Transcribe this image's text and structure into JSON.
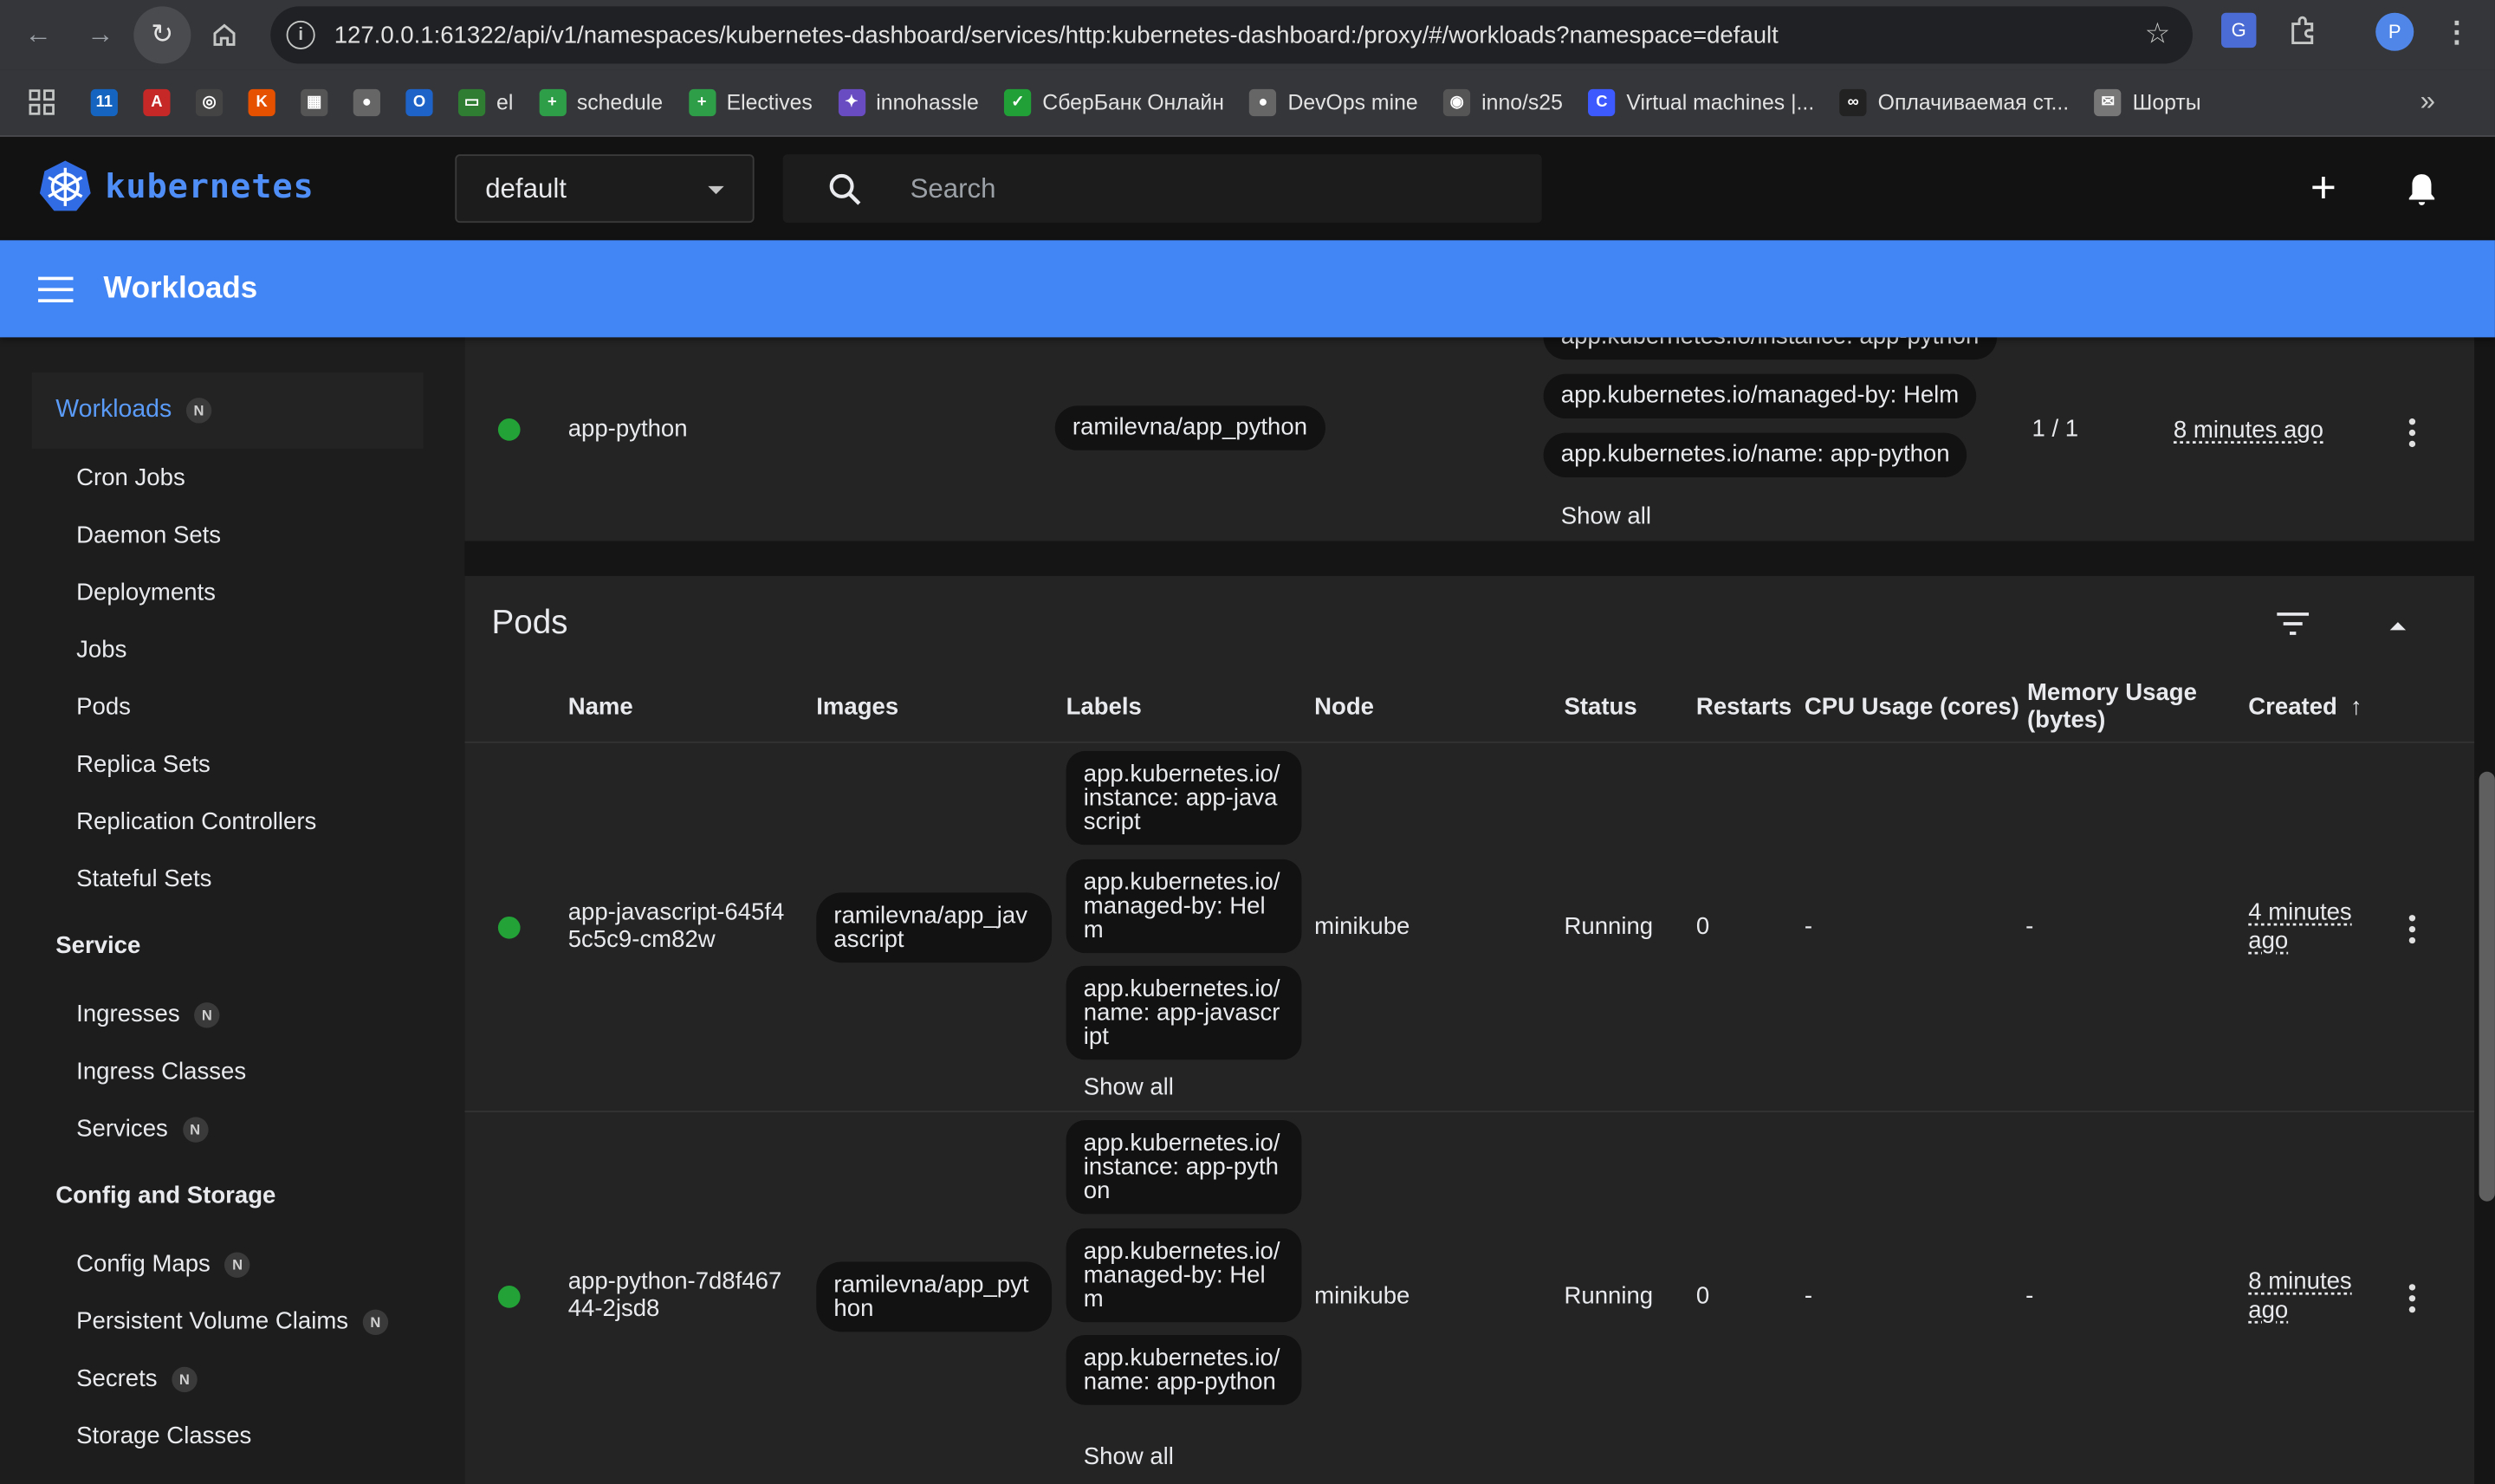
{
  "browser": {
    "url": "127.0.0.1:61322/api/v1/namespaces/kubernetes-dashboard/services/http:kubernetes-dashboard:/proxy/#/workloads?namespace=default",
    "profile_initial": "P",
    "bookmarks": [
      {
        "label": "",
        "icon": "11",
        "color": "#1565c0"
      },
      {
        "label": "",
        "icon": "A",
        "color": "#c62828"
      },
      {
        "label": "",
        "icon": "◎",
        "color": "#444"
      },
      {
        "label": "",
        "icon": "K",
        "color": "#e65100"
      },
      {
        "label": "",
        "icon": "▦",
        "color": "#555"
      },
      {
        "label": "",
        "icon": "●",
        "color": "#666"
      },
      {
        "label": "",
        "icon": "O",
        "color": "#1e64c8"
      },
      {
        "label": "el",
        "icon": "▭",
        "color": "#2e7d32"
      },
      {
        "label": "schedule",
        "icon": "+",
        "color": "#2e9e48"
      },
      {
        "label": "Electives",
        "icon": "+",
        "color": "#2e9e48"
      },
      {
        "label": "innohassle",
        "icon": "✦",
        "color": "#6a4cc2"
      },
      {
        "label": "СберБанк Онлайн",
        "icon": "✓",
        "color": "#21a038"
      },
      {
        "label": "DevOps mine",
        "icon": "●",
        "color": "#666"
      },
      {
        "label": "inno/s25",
        "icon": "◉",
        "color": "#555"
      },
      {
        "label": "Virtual machines |...",
        "icon": "C",
        "color": "#3d5afe"
      },
      {
        "label": "Оплачиваемая ст...",
        "icon": "∞",
        "color": "#222"
      },
      {
        "label": "Шорты",
        "icon": "✉",
        "color": "#777"
      }
    ]
  },
  "header": {
    "logo_text": "kubernetes",
    "namespace": "default",
    "search_placeholder": "Search"
  },
  "toolbar": {
    "title": "Workloads"
  },
  "sidebar": {
    "workloads": "Workloads",
    "workloads_badge": "N",
    "workload_items": [
      "Cron Jobs",
      "Daemon Sets",
      "Deployments",
      "Jobs",
      "Pods",
      "Replica Sets",
      "Replication Controllers",
      "Stateful Sets"
    ],
    "service": "Service",
    "service_items": [
      {
        "label": "Ingresses",
        "badge": "N"
      },
      {
        "label": "Ingress Classes",
        "badge": ""
      },
      {
        "label": "Services",
        "badge": "N"
      }
    ],
    "config": "Config and Storage",
    "config_items": [
      {
        "label": "Config Maps",
        "badge": "N"
      },
      {
        "label": "Persistent Volume Claims",
        "badge": "N"
      },
      {
        "label": "Secrets",
        "badge": "N"
      },
      {
        "label": "Storage Classes",
        "badge": ""
      }
    ]
  },
  "deployment_row": {
    "name": "app-python",
    "image": "ramilevna/app_python",
    "labels": [
      "app.kubernetes.io/instance: app-python",
      "app.kubernetes.io/managed-by: Helm",
      "app.kubernetes.io/name: app-python"
    ],
    "show_all": "Show all",
    "pods": "1 / 1",
    "created": "8 minutes ago"
  },
  "pods": {
    "title": "Pods",
    "columns": {
      "name": "Name",
      "images": "Images",
      "labels": "Labels",
      "node": "Node",
      "status": "Status",
      "restarts": "Restarts",
      "cpu": "CPU Usage (cores)",
      "memory": "Memory Usage (bytes)",
      "created": "Created"
    },
    "rows": [
      {
        "name": "app-javascript-645f45c5c9-cm82w",
        "image": "ramilevna/app_javascript",
        "labels": [
          "app.kubernetes.io/instance: app-javascript",
          "app.kubernetes.io/managed-by: Helm",
          "app.kubernetes.io/name: app-javascript"
        ],
        "show_all": "Show all",
        "node": "minikube",
        "status": "Running",
        "restarts": "0",
        "cpu": "-",
        "memory": "-",
        "created": "4 minutes ago"
      },
      {
        "name": "app-python-7d8f46744-2jsd8",
        "image": "ramilevna/app_python",
        "labels": [
          "app.kubernetes.io/instance: app-python",
          "app.kubernetes.io/managed-by: Helm",
          "app.kubernetes.io/name: app-python"
        ],
        "show_all": "Show all",
        "node": "minikube",
        "status": "Running",
        "restarts": "0",
        "cpu": "-",
        "memory": "-",
        "created": "8 minutes ago"
      }
    ]
  }
}
